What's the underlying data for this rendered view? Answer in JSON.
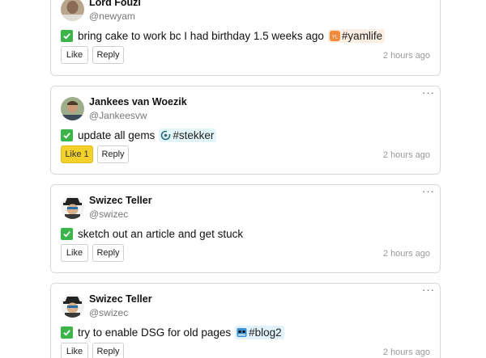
{
  "posts": [
    {
      "name": "Lord Fouzi",
      "handle": "@newyam",
      "task": "bring cake to work bc I had birthday 1.5 weeks ago",
      "tag": "#yamlife",
      "like_label": "Like",
      "reply_label": "Reply",
      "time": "2 hours ago"
    },
    {
      "name": "Jankees van Woezik",
      "handle": "@Jankeesvw",
      "task": "update all gems",
      "tag": "#stekker",
      "like_label": "Like 1",
      "reply_label": "Reply",
      "time": "2 hours ago"
    },
    {
      "name": "Swizec Teller",
      "handle": "@swizec",
      "task": "sketch out an article and get stuck",
      "like_label": "Like",
      "reply_label": "Reply",
      "time": "2 hours ago"
    },
    {
      "name": "Swizec Teller",
      "handle": "@swizec",
      "task": "try to enable DSG for old pages",
      "tag": "#blog2",
      "like_label": "Like",
      "reply_label": "Reply",
      "time": "2 hours ago"
    }
  ],
  "menu_glyph": "···",
  "colors": {
    "check": "#3bb54a",
    "liked": "#f4d02a",
    "yamlife_tag_bg": "#fbeee2",
    "stekker_tag_bg": "#e4f6f9",
    "blog2_tag_bg": "#e2f2fb"
  }
}
